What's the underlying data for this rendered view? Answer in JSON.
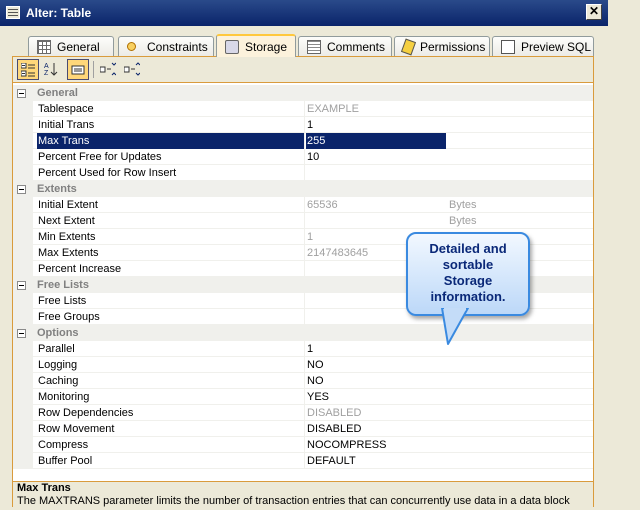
{
  "window": {
    "title": "Alter: Table",
    "close_glyph": "✕"
  },
  "tabs": [
    {
      "label": "General",
      "icon": "grid-icon",
      "active": false
    },
    {
      "label": "Constraints",
      "icon": "key-icon",
      "active": false
    },
    {
      "label": "Storage",
      "icon": "disk-icon",
      "active": true
    },
    {
      "label": "Comments",
      "icon": "note-icon",
      "active": false
    },
    {
      "label": "Permissions",
      "icon": "permission-icon",
      "active": false
    },
    {
      "label": "Preview SQL",
      "icon": "sql-icon",
      "active": false
    }
  ],
  "toolbar": {
    "buttons": [
      "categorized-icon",
      "alphabetical-sort-icon",
      "property-pages-icon",
      "expand-all-icon",
      "collapse-all-icon"
    ]
  },
  "grid": {
    "categories": [
      {
        "name": "General",
        "rows": [
          {
            "name": "Tablespace",
            "value": "EXAMPLE",
            "dim": true
          },
          {
            "name": "Initial Trans",
            "value": "1"
          },
          {
            "name": "Max Trans",
            "value": "255",
            "selected": true
          },
          {
            "name": "Percent Free for Updates",
            "value": "10"
          },
          {
            "name": "Percent Used for Row Insert",
            "value": ""
          }
        ]
      },
      {
        "name": "Extents",
        "rows": [
          {
            "name": "Initial Extent",
            "value": "65536",
            "unit": "Bytes",
            "dim": true
          },
          {
            "name": "Next Extent",
            "value": "",
            "unit": "Bytes"
          },
          {
            "name": "Min Extents",
            "value": "1",
            "dim": true
          },
          {
            "name": "Max Extents",
            "value": "2147483645",
            "dim": true
          },
          {
            "name": "Percent Increase",
            "value": ""
          }
        ]
      },
      {
        "name": "Free Lists",
        "rows": [
          {
            "name": "Free Lists",
            "value": ""
          },
          {
            "name": "Free Groups",
            "value": ""
          }
        ]
      },
      {
        "name": "Options",
        "rows": [
          {
            "name": "Parallel",
            "value": "1"
          },
          {
            "name": "Logging",
            "value": "NO"
          },
          {
            "name": "Caching",
            "value": "NO"
          },
          {
            "name": "Monitoring",
            "value": "YES"
          },
          {
            "name": "Row Dependencies",
            "value": "DISABLED",
            "dim": true
          },
          {
            "name": "Row Movement",
            "value": "DISABLED"
          },
          {
            "name": "Compress",
            "value": "NOCOMPRESS"
          },
          {
            "name": "Buffer Pool",
            "value": "DEFAULT"
          }
        ]
      }
    ]
  },
  "description": {
    "title": "Max Trans",
    "text": "The MAXTRANS parameter limits the number of transaction entries that can concurrently use data in a data block"
  },
  "callout": {
    "lines": [
      "Detailed and",
      "sortable",
      "Storage",
      "information."
    ]
  },
  "colors": {
    "selection": "#0a246a",
    "tab_highlight": "#ffc83c",
    "panel_border": "#d99b3c",
    "callout_border": "#3a8ae0"
  }
}
